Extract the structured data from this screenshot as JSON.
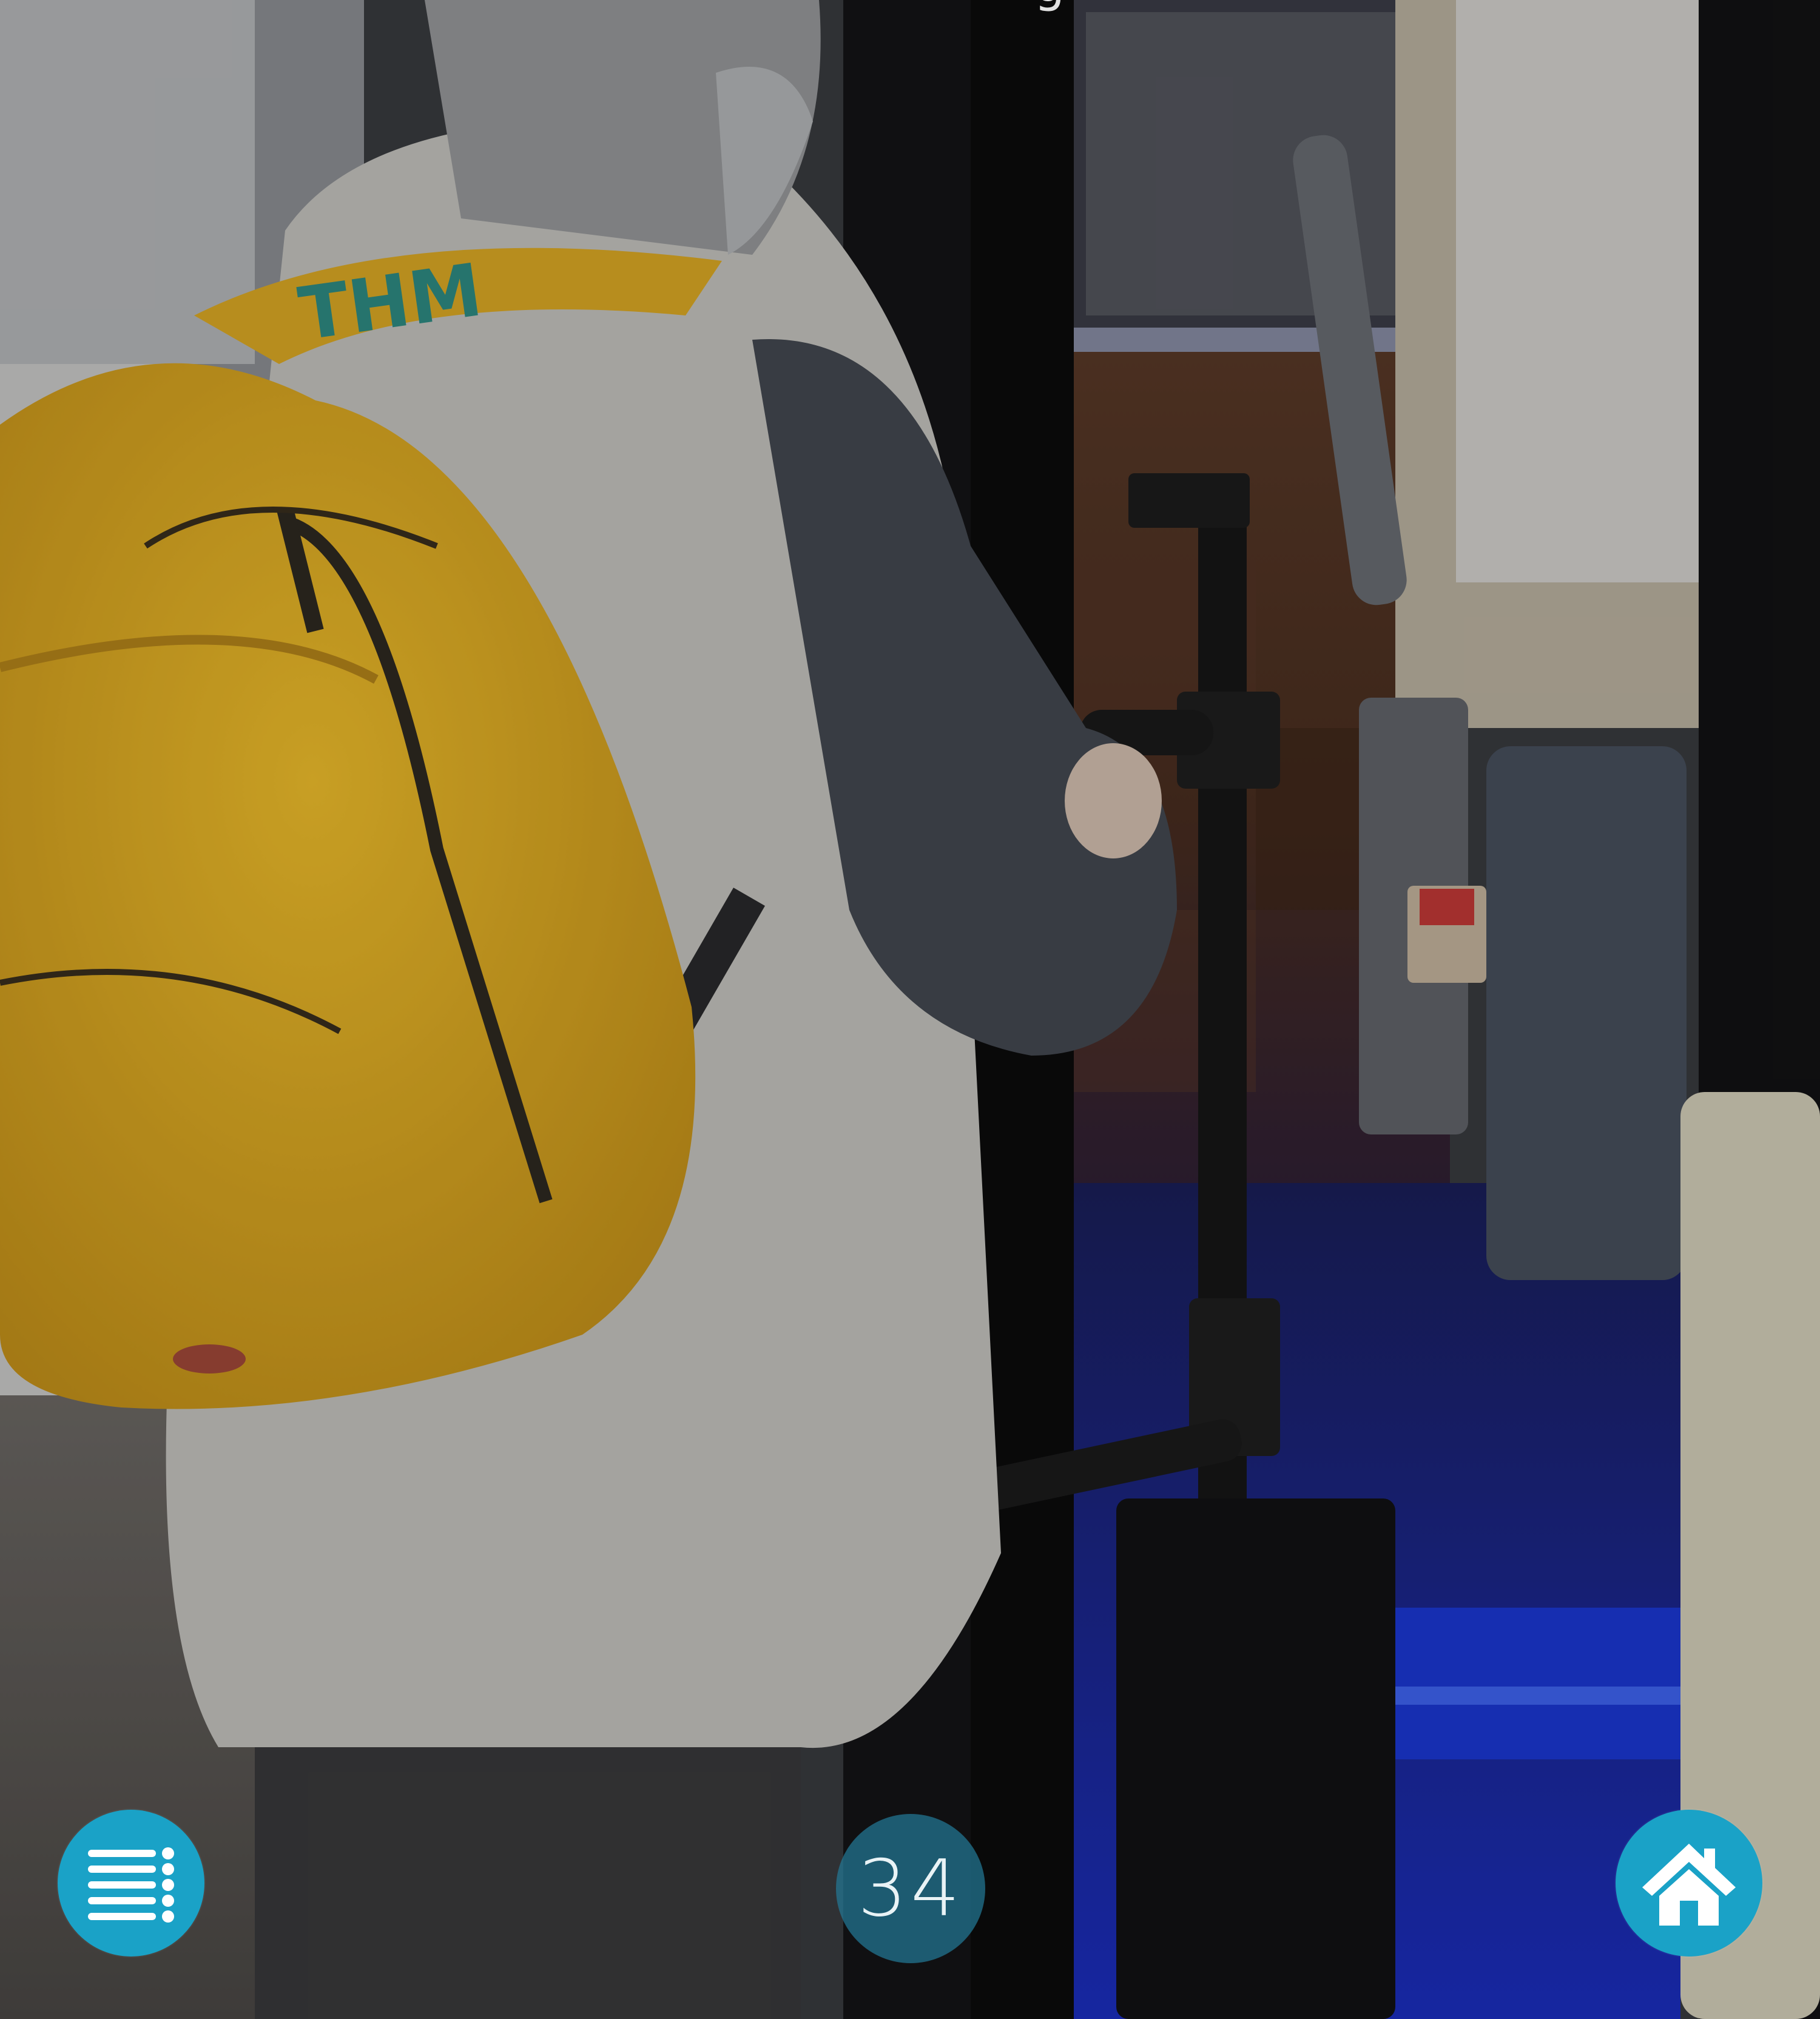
{
  "header": {
    "title_fragment": "g"
  },
  "photo": {
    "subject": "person-with-yellow-backpack-boarding-bus"
  },
  "nav": {
    "menu_icon": "list-menu-icon",
    "page_number": "34",
    "home_icon": "home-icon"
  },
  "colors": {
    "button_bg": "#1aa2c7",
    "badge_bg": "#22789699",
    "backpack": "#e9b524",
    "vest": "#c8c7c2",
    "floor_light": "#2d3fd6"
  }
}
